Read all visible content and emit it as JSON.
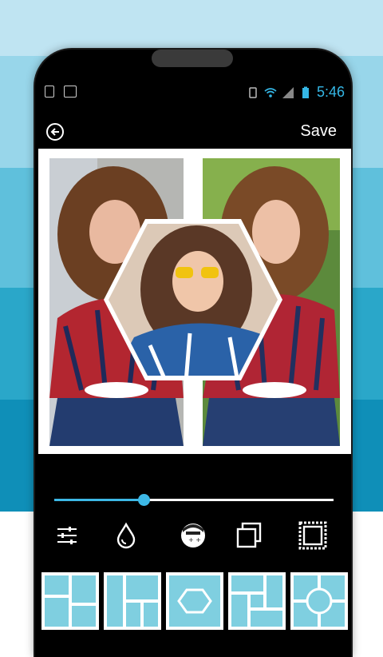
{
  "status_bar": {
    "time": "5:46"
  },
  "app_bar": {
    "save_label": "Save",
    "back_icon": "back-arrow-icon"
  },
  "collage": {
    "photo_left": "woman-plaid-shirt-photo",
    "photo_right": "woman-plaid-shirt-photo",
    "photo_center": "woman-sunglasses-photo"
  },
  "slider": {
    "value": 0.32
  },
  "tools": [
    {
      "name": "adjust",
      "icon": "sliders-icon"
    },
    {
      "name": "color",
      "icon": "drop-icon"
    },
    {
      "name": "sticker",
      "icon": "sticker-face-icon"
    },
    {
      "name": "layers",
      "icon": "layers-icon"
    },
    {
      "name": "frame",
      "icon": "frame-icon"
    }
  ],
  "layouts": [
    {
      "name": "layout-grid-1"
    },
    {
      "name": "layout-grid-2"
    },
    {
      "name": "layout-hexagon"
    },
    {
      "name": "layout-grid-3"
    },
    {
      "name": "layout-circle"
    }
  ],
  "colors": {
    "accent": "#3db8e6",
    "layout_tile": "#7fcfe0",
    "bg_stripe_1": "#bfe4f2",
    "bg_stripe_2": "#98d6ea",
    "bg_stripe_3": "#5fc0dc",
    "bg_stripe_4": "#2aa7c9",
    "bg_stripe_5": "#0f8fb8"
  }
}
